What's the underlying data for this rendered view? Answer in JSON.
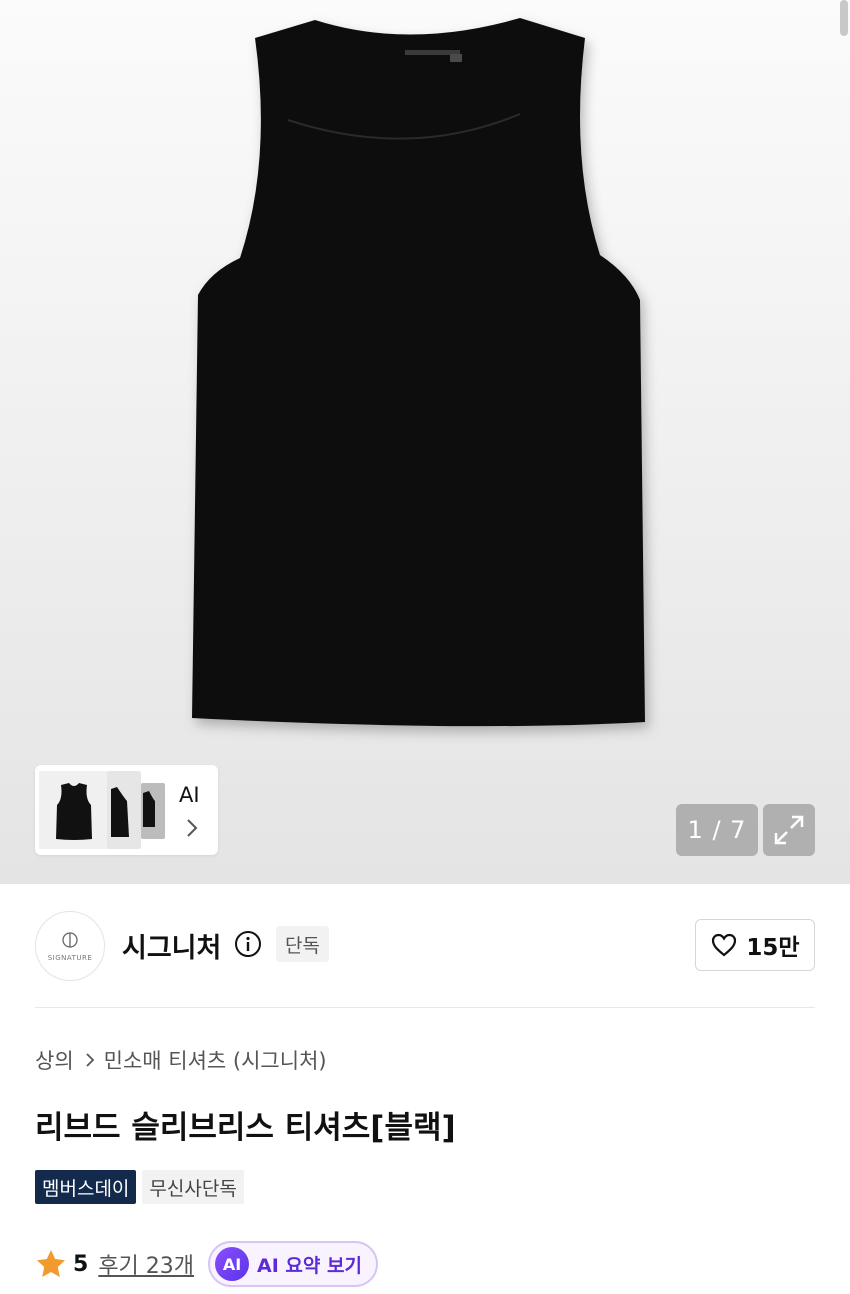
{
  "gallery": {
    "counter": "1 / 7",
    "thumb_label": "AI"
  },
  "brand": {
    "logo_text": "SIGNATURE",
    "name": "시그니처",
    "exclusive_badge": "단독",
    "like_count": "15만"
  },
  "breadcrumb": {
    "category": "상의",
    "subcategory": "민소매 티셔츠 (시그니처)"
  },
  "product": {
    "title": "리브드 슬리브리스 티셔츠[블랙]",
    "tags": [
      "멤버스데이",
      "무신사단독"
    ]
  },
  "rating": {
    "score": "5",
    "reviews": "후기 23개",
    "ai_badge": "AI",
    "ai_summary": "AI 요약 보기"
  },
  "colors": {
    "tag_dark": "#132a4d",
    "star": "#f29a2e",
    "ai_purple": "#5b2bd8"
  }
}
